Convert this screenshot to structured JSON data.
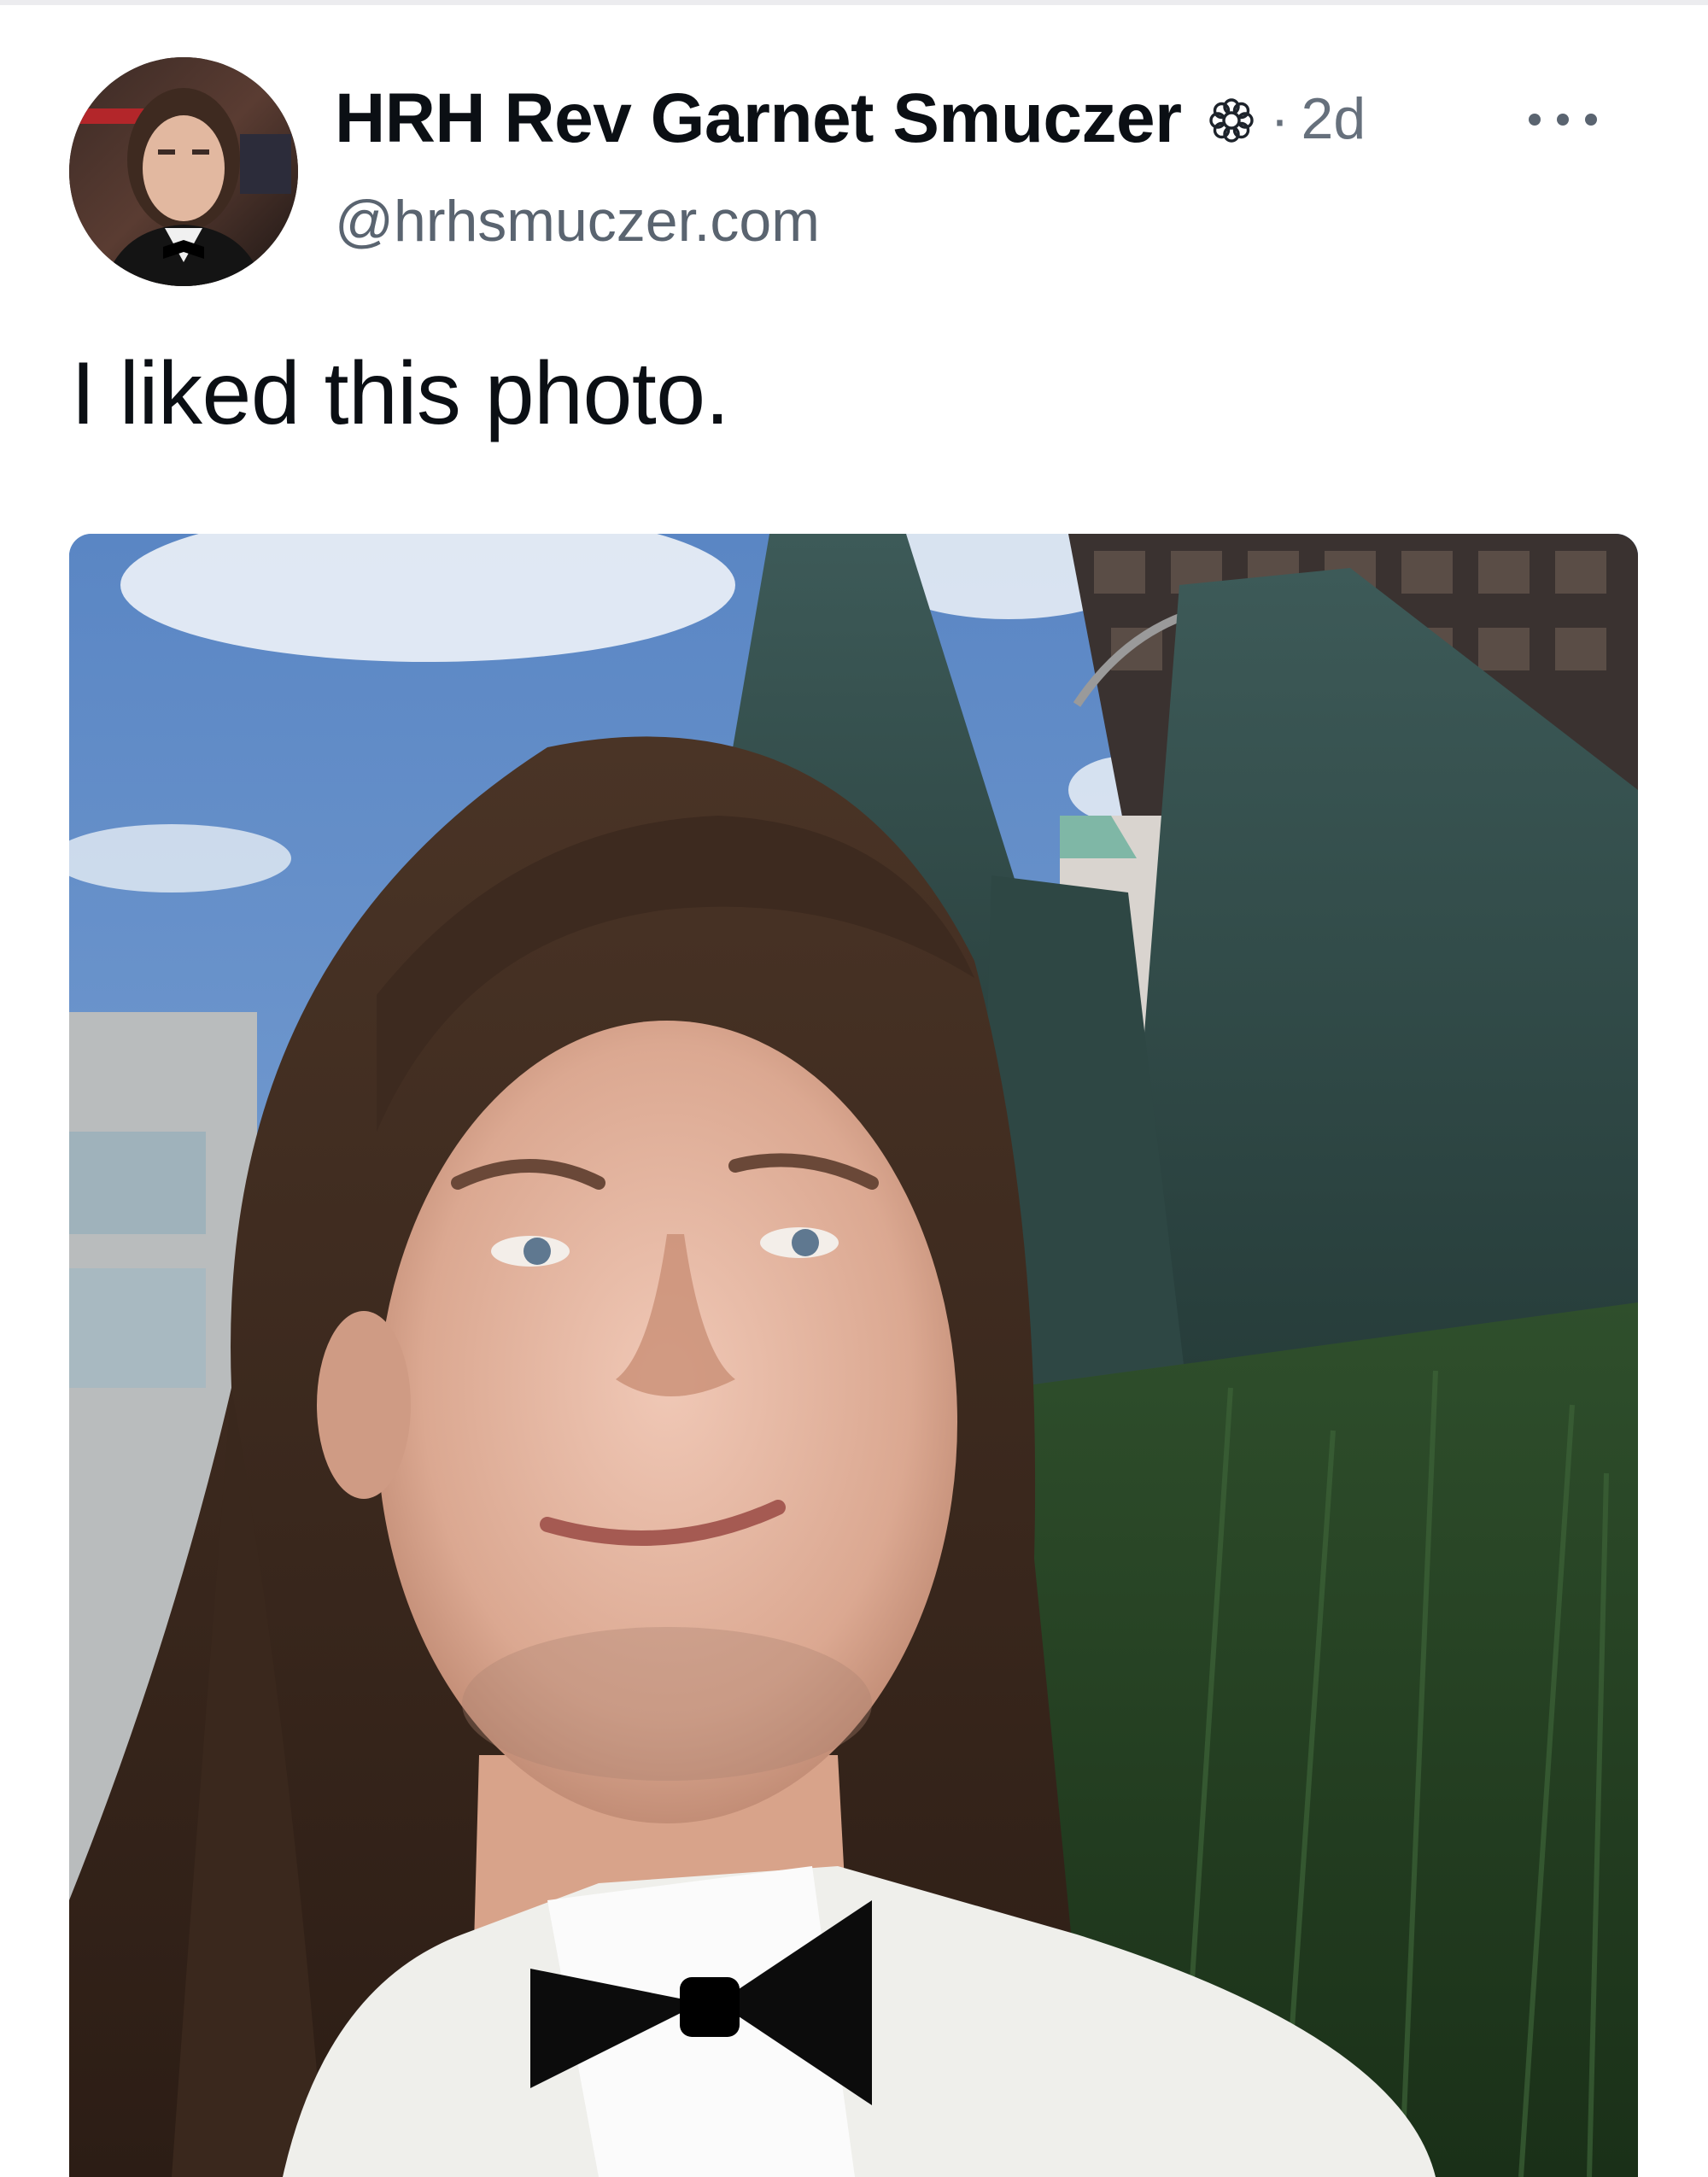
{
  "post": {
    "author": {
      "display_name": "HRH Rev Garnet Smuczer",
      "handle": "@hrhsmuczer.com",
      "badge_icon": "flower-icon",
      "avatar_alt": "avatar"
    },
    "separator": "·",
    "timestamp": "2d",
    "more_icon": "more-options-icon",
    "text": "I liked this photo.",
    "image": {
      "description_icon": "photo"
    }
  },
  "colors": {
    "text_primary": "#0b0f14",
    "text_secondary": "#66707c",
    "background": "#ffffff"
  }
}
